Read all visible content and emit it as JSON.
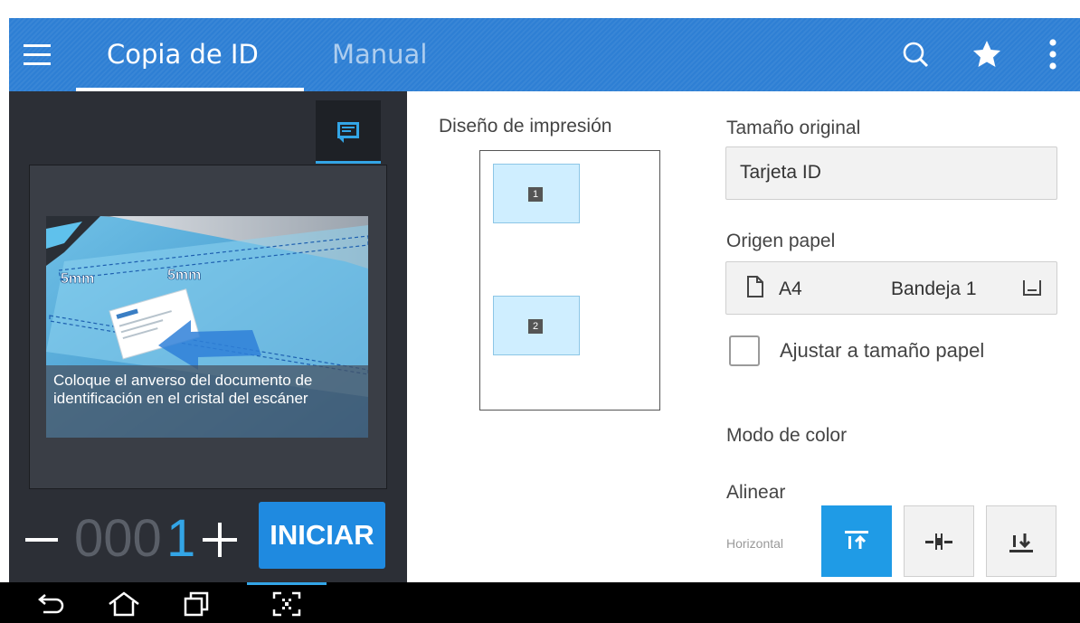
{
  "appbar": {
    "tabs": [
      {
        "label": "Copia de ID",
        "active": true
      },
      {
        "label": "Manual",
        "active": false
      }
    ],
    "icons": [
      "menu-icon",
      "search-icon",
      "star-icon",
      "more-vert-icon"
    ],
    "color": "#2e7fd4"
  },
  "preview": {
    "illustration_labels": [
      "5mm",
      "5mm"
    ],
    "caption": "Coloque el anverso del documento de identificación en el cristal del escáner"
  },
  "copies": {
    "prefix": "000",
    "digit": "1",
    "start_label": "INICIAR"
  },
  "layout": {
    "title": "Diseño de impresión",
    "cells": [
      "1",
      "2"
    ]
  },
  "settings": {
    "original_size_label": "Tamaño original",
    "original_size_value": "Tarjeta ID",
    "paper_source_label": "Origen papel",
    "paper_size": "A4",
    "tray": "Bandeja 1",
    "fit_label": "Ajustar a tamaño papel",
    "fit_checked": false,
    "color_mode_label": "Modo de color",
    "align_label": "Alinear",
    "align_sub": "Horizontal",
    "align_selected": "top"
  },
  "accent": "#1f9be6"
}
